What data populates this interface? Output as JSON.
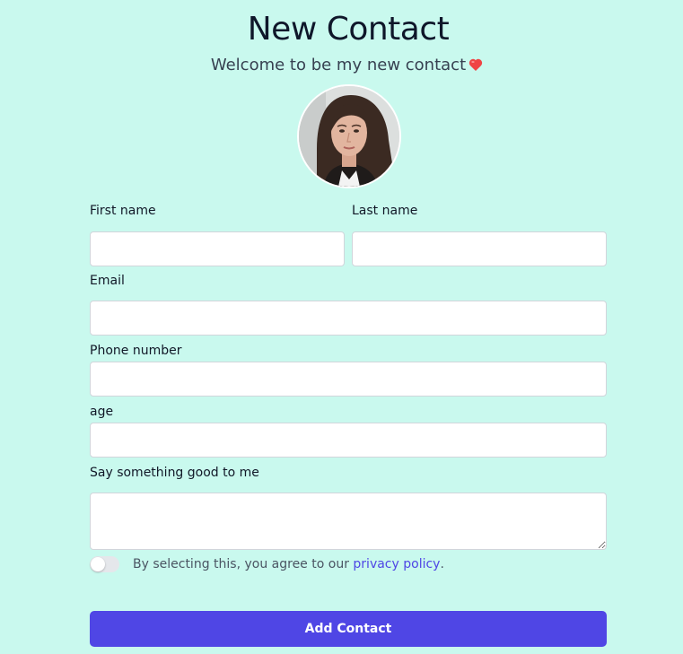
{
  "header": {
    "title": "New Contact",
    "subtitle": "Welcome to be my new contact"
  },
  "avatar": {
    "icon": "avatar-photo"
  },
  "form": {
    "first_name": {
      "label": "First name",
      "value": ""
    },
    "last_name": {
      "label": "Last name",
      "value": ""
    },
    "email": {
      "label": "Email",
      "value": ""
    },
    "phone": {
      "label": "Phone number",
      "value": ""
    },
    "age": {
      "label": "age",
      "value": ""
    },
    "message": {
      "label": "Say something good to me",
      "value": ""
    },
    "agreement": {
      "text": "By selecting this, you agree to our ",
      "link": "privacy policy",
      "suffix": ".",
      "checked": false
    },
    "submit_label": "Add Contact"
  },
  "colors": {
    "background": "#c9f9ee",
    "accent": "#4f46e5",
    "heart": "#ef4444"
  }
}
